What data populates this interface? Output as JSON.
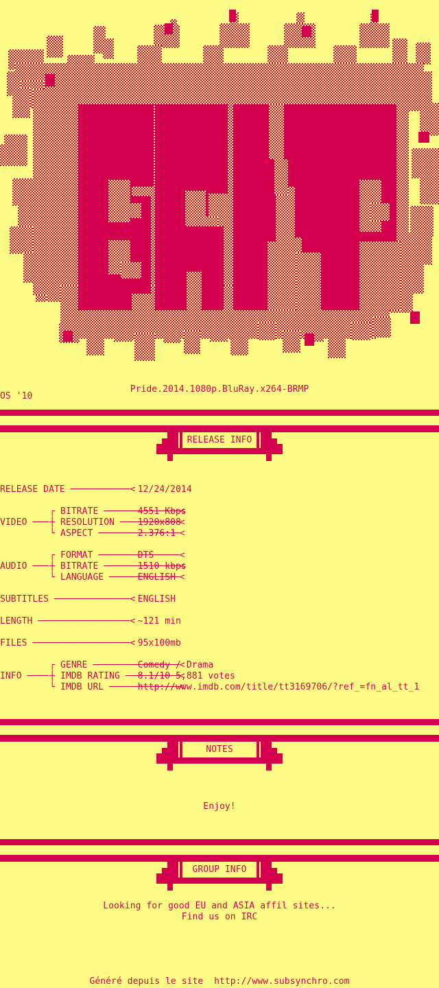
{
  "logo": {
    "group": "BRMP",
    "art_style": "ascii-splat-dither",
    "artist_tag": "OS '10"
  },
  "release": {
    "title": "Pride.2014.1080p.BluRay.x264-BRMP"
  },
  "colors": {
    "background": "#fbfb85",
    "foreground": "#d4004f"
  },
  "sections": {
    "release_info": {
      "label": "RELEASE INFO"
    },
    "notes": {
      "label": "NOTES",
      "body": "Enjoy!"
    },
    "group_info": {
      "label": "GROUP INFO",
      "line1": "Looking for good EU and ASIA affil sites...",
      "line2": "Find us on IRC"
    }
  },
  "info_rows": [
    {
      "label": "RELEASE DATE",
      "dashes": "───────────────────────",
      "marker": "<",
      "value": "12/24/2014"
    }
  ],
  "groups": [
    {
      "name": "VIDEO",
      "connector": "────",
      "rows": [
        {
          "branch": "┌",
          "label": "BITRATE",
          "dashes": "─────────",
          "marker": "<",
          "value": "4551 Kbps"
        },
        {
          "branch": "┼",
          "label": "RESOLUTION",
          "dashes": "──────",
          "marker": "<",
          "value": "1920x808"
        },
        {
          "branch": "└",
          "label": "ASPECT",
          "dashes": "──────────",
          "marker": "<",
          "value": "2.376:1"
        }
      ]
    },
    {
      "name": "AUDIO",
      "connector": "────",
      "rows": [
        {
          "branch": "┌",
          "label": "FORMAT",
          "dashes": "──────────",
          "marker": "<",
          "value": "DTS"
        },
        {
          "branch": "┼",
          "label": "BITRATE",
          "dashes": "─────────",
          "marker": "<",
          "value": "1510 kbps"
        },
        {
          "branch": "└",
          "label": "LANGUAGE",
          "dashes": "────────",
          "marker": "<",
          "value": "ENGLISH"
        }
      ]
    }
  ],
  "info_rows2": [
    {
      "label": "SUBTITLES",
      "dashes": "──────────────────────────",
      "marker": "<",
      "value": "ENGLISH"
    },
    {
      "label": "LENGTH",
      "dashes": "─────────────────────────────",
      "marker": "<",
      "value": "~121 min"
    },
    {
      "label": "FILES",
      "dashes": "──────────────────────────────",
      "marker": "<",
      "value": "95x100mb"
    }
  ],
  "info_group": {
    "name": "INFO",
    "connector": "─────",
    "rows": [
      {
        "branch": "┌",
        "label": "GENRE",
        "dashes": "───────────",
        "marker": "<",
        "value": "Comedy / Drama"
      },
      {
        "branch": "┼",
        "label": "IMDB RATING",
        "dashes": "───",
        "marker": "<",
        "value": "8.1/10 5,881 votes"
      },
      {
        "branch": "└",
        "label": "IMDB URL",
        "dashes": "───────",
        "marker": "<",
        "value": "http://www.imdb.com/title/tt3169706/?ref_=fn_al_tt_1"
      }
    ]
  },
  "footer": {
    "text": "Généré depuis le site  http://www.subsynchro.com"
  }
}
